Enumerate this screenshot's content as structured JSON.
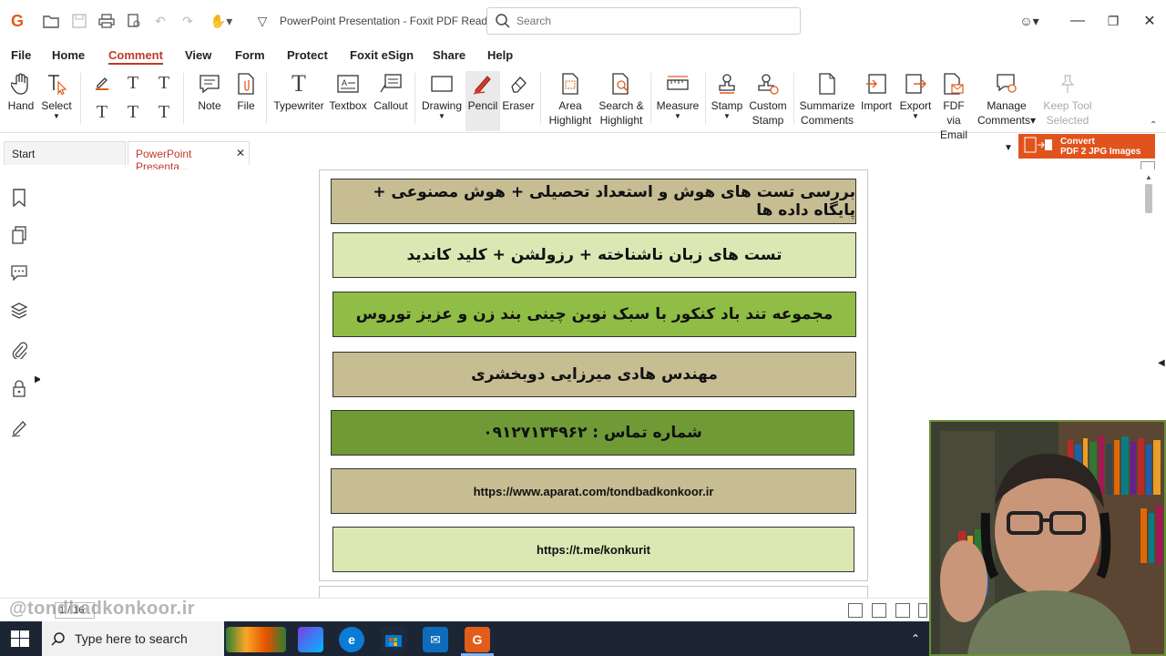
{
  "window": {
    "title": "PowerPoint Presentation - Foxit PDF Reader",
    "logo": "G"
  },
  "search": {
    "placeholder": "Search"
  },
  "menu": {
    "items": [
      "File",
      "Home",
      "Comment",
      "View",
      "Form",
      "Protect",
      "Foxit eSign",
      "Share",
      "Help"
    ],
    "active": "Comment"
  },
  "ribbon": {
    "hand": "Hand",
    "select": "Select",
    "note": "Note",
    "file": "File",
    "typewriter": "Typewriter",
    "textbox": "Textbox",
    "callout": "Callout",
    "drawing": "Drawing",
    "pencil": "Pencil",
    "eraser": "Eraser",
    "area_highlight_1": "Area",
    "area_highlight_2": "Highlight",
    "search_highlight_1": "Search &",
    "search_highlight_2": "Highlight",
    "measure": "Measure",
    "stamp": "Stamp",
    "custom_stamp_1": "Custom",
    "custom_stamp_2": "Stamp",
    "summarize_1": "Summarize",
    "summarize_2": "Comments",
    "import": "Import",
    "export": "Export",
    "fdf_1": "FDF via",
    "fdf_2": "Email",
    "manage_1": "Manage",
    "manage_2": "Comments",
    "keep_1": "Keep Tool",
    "keep_2": "Selected"
  },
  "tabs": {
    "start": "Start",
    "doc": "PowerPoint Presenta..."
  },
  "banner": {
    "line1": "Convert",
    "line2": "PDF 2 JPG Images"
  },
  "slide": {
    "box1": "بررسی  تست  های هوش و استعداد تحصیلی + هوش مصنوعی + پایگاه  داده ها",
    "box2": "تست های زبان ناشناخته + رزولشن + کلید کاندید",
    "box3": "مجموعه تند باد کنکور با سبک نوین چینی بند زن و عزیز توروس",
    "box4": "مهندس هادی میرزایی دوبخشری",
    "box5": "شماره تماس : ۰۹۱۲۷۱۳۴۹۶۲",
    "box6": "https://www.aparat.com/tondbadkonkoor.ir",
    "box7": "https://t.me/konkurit"
  },
  "status": {
    "page": "1 / 16",
    "watermark": "@tondbadkonkoor.ir"
  },
  "taskbar": {
    "search_text": "Type here to search"
  },
  "colors": {
    "accent": "#c0392b",
    "slide_tan": "#c7bd93",
    "slide_light_green": "#dbe8b4",
    "slide_green": "#8fbd45",
    "slide_dark_green": "#6f9a35",
    "taskbar": "#1c2534"
  }
}
